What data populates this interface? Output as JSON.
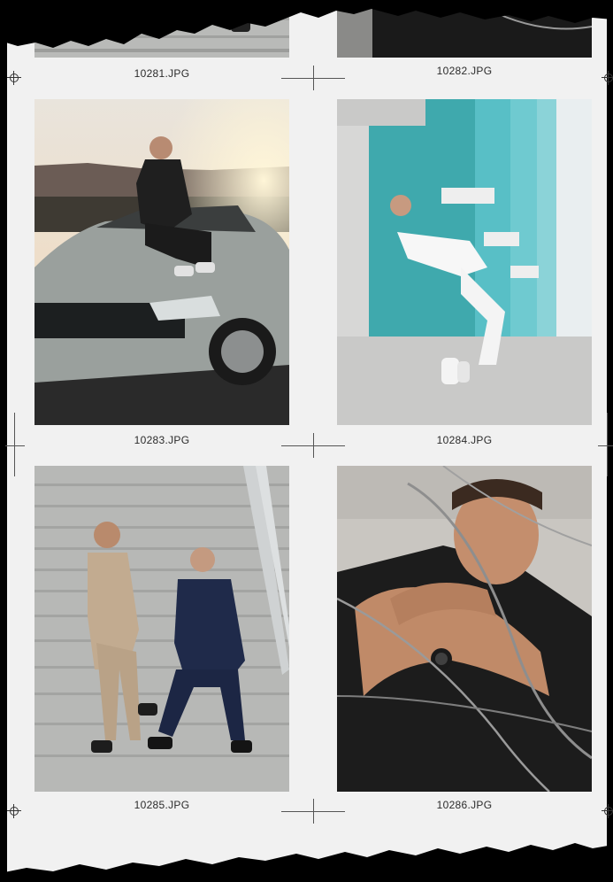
{
  "captions": {
    "c1": "10281.JPG",
    "c2": "10282.JPG",
    "c3": "10283.JPG",
    "c4": "10284.JPG",
    "c5": "10285.JPG",
    "c6": "10286.JPG"
  },
  "photos": {
    "p1": "stairs-photo",
    "p2": "dark-photo",
    "p3": "man-on-car-photo",
    "p4": "man-white-outfit-photo",
    "p5": "men-in-suits-on-stairs-photo",
    "p6": "man-with-wire-photo"
  },
  "colors": {
    "paper": "#f1f1f1",
    "background": "#000000",
    "caption_text": "#2b2b2b",
    "teal_building": "#3fa9ad"
  }
}
